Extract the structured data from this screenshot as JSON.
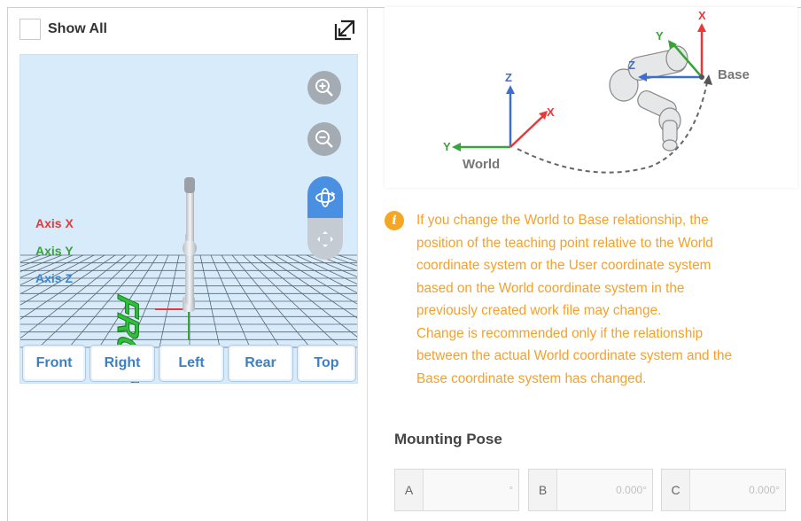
{
  "left_panel": {
    "show_all_label": "Show All",
    "axis_labels": {
      "x": "Axis X",
      "y": "Axis Y",
      "z": "Axis Z"
    },
    "front_floor_text": "FRONT",
    "view_buttons": [
      "Front",
      "Right",
      "Left",
      "Rear",
      "Top"
    ]
  },
  "diagram": {
    "world_label": "World",
    "base_label": "Base",
    "axis_letters": {
      "x": "X",
      "y": "Y",
      "z": "Z"
    }
  },
  "info": {
    "icon": "info-icon",
    "lines": [
      "If you change the World to Base relationship, the",
      "position of the teaching point relative to the World",
      "coordinate system or the User coordinate system",
      "based on the World coordinate system in the",
      "previously created work file may change.",
      "Change is recommended only if the relationship",
      "between the actual World coordinate system and the",
      "Base coordinate system has changed."
    ]
  },
  "mounting_pose": {
    "title": "Mounting Pose",
    "fields": [
      {
        "label": "A",
        "value": "°"
      },
      {
        "label": "B",
        "value": "0.000°"
      },
      {
        "label": "C",
        "value": "0.000°"
      }
    ]
  },
  "colors": {
    "accent": "#4a90e2",
    "warning": "#f5a623",
    "axis_x": "#e8393a",
    "axis_y": "#39a33a",
    "axis_z": "#3d88cf"
  }
}
